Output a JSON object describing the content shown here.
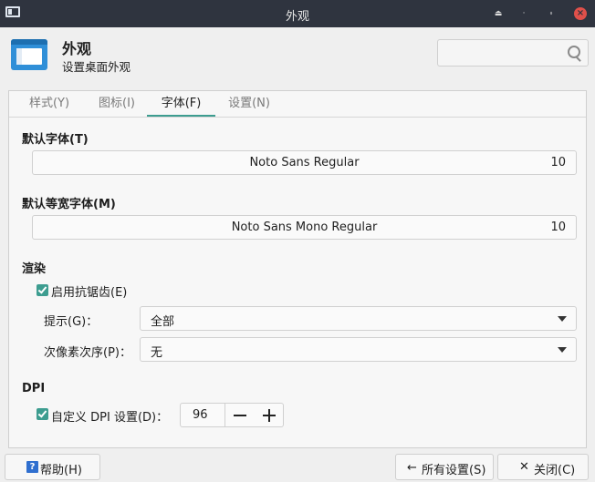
{
  "window": {
    "title": "外观"
  },
  "header": {
    "title": "外观",
    "subtitle": "设置桌面外观",
    "search_placeholder": ""
  },
  "tabs": [
    {
      "label": "样式(Y)",
      "mnemonic": "Y"
    },
    {
      "label": "图标(I)",
      "mnemonic": "I"
    },
    {
      "label": "字体(F)",
      "mnemonic": "F"
    },
    {
      "label": "设置(N)",
      "mnemonic": "N"
    }
  ],
  "active_tab": "字体(F)",
  "fonts": {
    "default_label": "默认字体(T)",
    "default_font": "Noto Sans Regular",
    "default_size": "10",
    "mono_label": "默认等宽字体(M)",
    "mono_font": "Noto Sans Mono Regular",
    "mono_size": "10"
  },
  "rendering": {
    "label": "渲染",
    "antialias_label": "启用抗锯齿(E)",
    "antialias_checked": true,
    "hinting_label": "提示(G)：",
    "hinting_value": "全部",
    "subpixel_label": "次像素次序(P)：",
    "subpixel_value": "无"
  },
  "dpi": {
    "label": "DPI",
    "custom_label": "自定义 DPI 设置(D)：",
    "custom_checked": true,
    "value": "96"
  },
  "footer": {
    "help_label": "帮助(H)",
    "all_settings_label": "所有设置(S)",
    "close_label": "关闭(C)"
  },
  "colors": {
    "titlebar": "#2f343f",
    "accent": "#3d9d90",
    "close": "#e0504a",
    "icon_blue": "#2f8fd8"
  }
}
